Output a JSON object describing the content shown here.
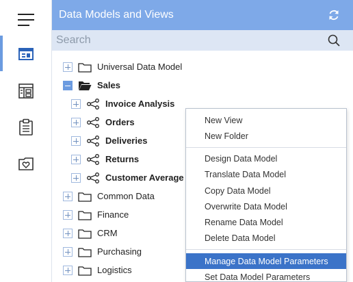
{
  "header": {
    "title": "Data Models and Views"
  },
  "search": {
    "placeholder": "Search"
  },
  "tree": {
    "items": [
      {
        "label": "Universal Data Model"
      },
      {
        "label": "Sales"
      },
      {
        "label": "Invoice Analysis"
      },
      {
        "label": "Orders"
      },
      {
        "label": "Deliveries"
      },
      {
        "label": "Returns"
      },
      {
        "label": "Customer Average R"
      },
      {
        "label": "Common Data"
      },
      {
        "label": "Finance"
      },
      {
        "label": "CRM"
      },
      {
        "label": "Purchasing"
      },
      {
        "label": "Logistics"
      }
    ]
  },
  "menu": {
    "items": [
      {
        "label": "New View"
      },
      {
        "label": "New Folder"
      },
      {
        "label": "Design Data Model"
      },
      {
        "label": "Translate Data Model"
      },
      {
        "label": "Copy Data Model"
      },
      {
        "label": "Overwrite Data Model"
      },
      {
        "label": "Rename Data Model"
      },
      {
        "label": "Delete Data Model"
      },
      {
        "label": "Manage Data Model Parameters"
      },
      {
        "label": "Set Data Model Parameters"
      }
    ],
    "highlighted": "Manage Data Model Parameters"
  },
  "colors": {
    "header_bg": "#7ea9e8",
    "search_bg": "#dde6f4",
    "accent": "#6b9be0",
    "menu_highlight": "#3b73c8"
  },
  "icons": {
    "rail": [
      "hamburger-menu-icon",
      "data-model-icon",
      "dashboard-icon",
      "clipboard-icon",
      "favorites-icon"
    ],
    "header": "refresh-icon",
    "search": "search-icon"
  }
}
